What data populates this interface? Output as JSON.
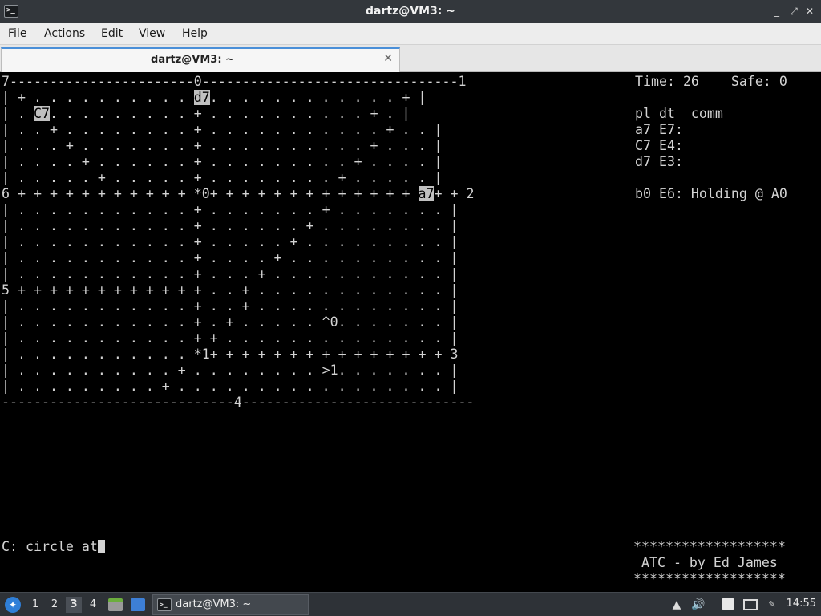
{
  "window": {
    "title": "dartz@VM3: ~",
    "buttons": [
      "_",
      "⤢",
      "✕"
    ]
  },
  "menubar": {
    "items": [
      "File",
      "Actions",
      "Edit",
      "View",
      "Help"
    ]
  },
  "tab": {
    "label": "dartz@VM3: ~",
    "close": "✕"
  },
  "terminal": {
    "screen": [
      [
        {
          "t": "7-----------------------0--------------------------------1"
        }
      ],
      [
        {
          "t": "| + . . . . . . . . . . "
        },
        {
          "t": "d7",
          "hl": true
        },
        {
          "t": ". . . . . . . . . . . . + |"
        }
      ],
      [
        {
          "t": "| . "
        },
        {
          "t": "C7",
          "hl": true
        },
        {
          "t": ". . . . . . . . . + . . . . . . . . . . + . |"
        }
      ],
      [
        {
          "t": "| . . + . . . . . . . . + . . . . . . . . . . . + . . |"
        }
      ],
      [
        {
          "t": "| . . . + . . . . . . . + . . . . . . . . . . + . . . |"
        }
      ],
      [
        {
          "t": "| . . . . + . . . . . . + . . . . . . . . . + . . . . |"
        }
      ],
      [
        {
          "t": "| . . . . . + . . . . . + . . . . . . . . + . . . . . |"
        }
      ],
      [
        {
          "t": "6 + + + + + + + + + + + *0+ + + + + + + + + + + + + "
        },
        {
          "t": "a7",
          "hl": true
        },
        {
          "t": "+ + 2"
        }
      ],
      [
        {
          "t": "| . . . . . . . . . . . + . . . . . . . + . . . . . . . |"
        }
      ],
      [
        {
          "t": "| . . . . . . . . . . . + . . . . . . + . . . . . . . . |"
        }
      ],
      [
        {
          "t": "| . . . . . . . . . . . + . . . . . + . . . . . . . . . |"
        }
      ],
      [
        {
          "t": "| . . . . . . . . . . . + . . . . + . . . . . . . . . . |"
        }
      ],
      [
        {
          "t": "| . . . . . . . . . . . + . . . + . . . . . . . . . . . |"
        }
      ],
      [
        {
          "t": "5 + + + + + + + + + + + + . . + . . . . . . . . . . . . |"
        }
      ],
      [
        {
          "t": "| . . . . . . . . . . . + . . + . . . . . . . . . . . . |"
        }
      ],
      [
        {
          "t": "| . . . . . . . . . . . + . + . . . . . ^0. . . . . . . |"
        }
      ],
      [
        {
          "t": "| . . . . . . . . . . . + + . . . . . . . . . . . . . . |"
        }
      ],
      [
        {
          "t": "| . . . . . . . . . . . *1+ + + + + + + + + + + + + + + 3"
        }
      ],
      [
        {
          "t": "| . . . . . . . . . . + . . . . . . . . >1. . . . . . . |"
        }
      ],
      [
        {
          "t": "| . . . . . . . . . + . . . . . . . . . . . . . . . . . |"
        }
      ],
      [
        {
          "t": "-----------------------------4-----------------------------"
        }
      ]
    ],
    "side": [
      {
        "row": 0,
        "t": "Time: 26    Safe: 0"
      },
      {
        "row": 2,
        "t": "pl dt  comm"
      },
      {
        "row": 3,
        "t": "a7 E7:"
      },
      {
        "row": 4,
        "t": "C7 E4:"
      },
      {
        "row": 5,
        "t": "d7 E3:"
      },
      {
        "row": 7,
        "t": "b0 E6: Holding @ A0"
      }
    ],
    "prompt": "C: circle at",
    "banner": [
      "*******************",
      " ATC - by Ed James",
      "*******************"
    ]
  },
  "taskbar": {
    "workspaces": [
      "1",
      "2",
      "3",
      "4"
    ],
    "active_workspace": "3",
    "task_label": "dartz@VM3: ~",
    "clock": "14:55"
  }
}
